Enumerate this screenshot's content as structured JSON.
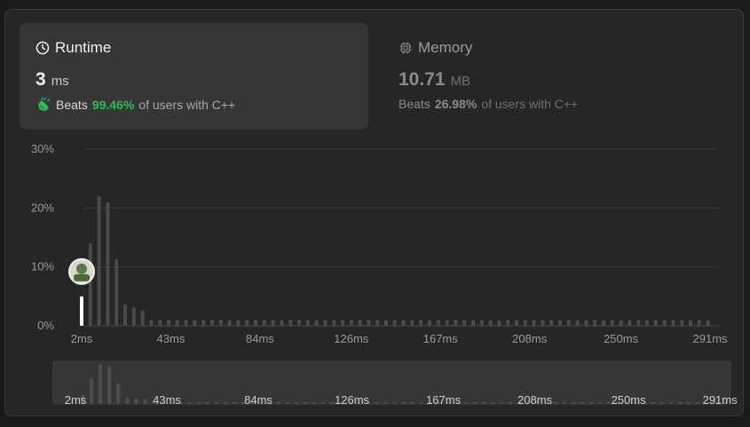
{
  "runtime": {
    "title": "Runtime",
    "value": "3",
    "unit": "ms",
    "beats_label": "Beats",
    "beats_pct": "99.46%",
    "beats_suffix": "of users with C++",
    "icon": "clock-icon"
  },
  "memory": {
    "title": "Memory",
    "value": "10.71",
    "unit": "MB",
    "beats_label": "Beats",
    "beats_pct": "26.98%",
    "beats_suffix": "of users with C++",
    "icon": "chip-icon"
  },
  "colors": {
    "accent_green": "#2cbb5d",
    "bar": "#4a4a4a",
    "highlight_bar": "#ffffff",
    "panel_bg": "#262626",
    "card_bg": "#363636"
  },
  "chart_data": {
    "type": "bar",
    "title": "",
    "xlabel": "",
    "ylabel": "",
    "ylim": [
      0,
      30
    ],
    "y_ticks": [
      "30%",
      "20%",
      "10%",
      "0%"
    ],
    "y_tick_values": [
      30,
      20,
      10,
      0
    ],
    "x_tick_labels": [
      "2ms",
      "43ms",
      "84ms",
      "126ms",
      "167ms",
      "208ms",
      "250ms",
      "291ms"
    ],
    "x_tick_values": [
      2,
      43,
      84,
      126,
      167,
      208,
      250,
      291
    ],
    "bin_width_ms": 4,
    "x_start_ms": 2,
    "values": [
      5,
      14,
      22,
      21,
      11.3,
      3.6,
      3.1,
      2.6,
      1,
      1,
      1,
      1,
      1,
      1,
      1,
      1,
      1,
      1,
      1,
      1,
      1,
      1,
      1,
      1,
      1,
      1,
      1,
      1,
      1,
      1,
      1,
      1,
      1,
      1,
      1,
      1,
      1,
      1,
      1,
      1,
      1,
      1,
      1,
      1,
      1,
      1,
      1,
      1,
      1,
      1,
      1,
      1,
      1,
      1,
      1,
      1,
      1,
      1,
      1,
      1,
      1,
      1,
      1,
      1,
      1,
      1,
      1,
      1,
      1,
      1,
      1,
      1,
      1
    ],
    "highlight_index": 0,
    "grid": true,
    "marker": "user-avatar"
  },
  "scrubber": {
    "x_tick_labels": [
      "2ms",
      "43ms",
      "84ms",
      "126ms",
      "167ms",
      "208ms",
      "250ms",
      "291ms"
    ]
  }
}
